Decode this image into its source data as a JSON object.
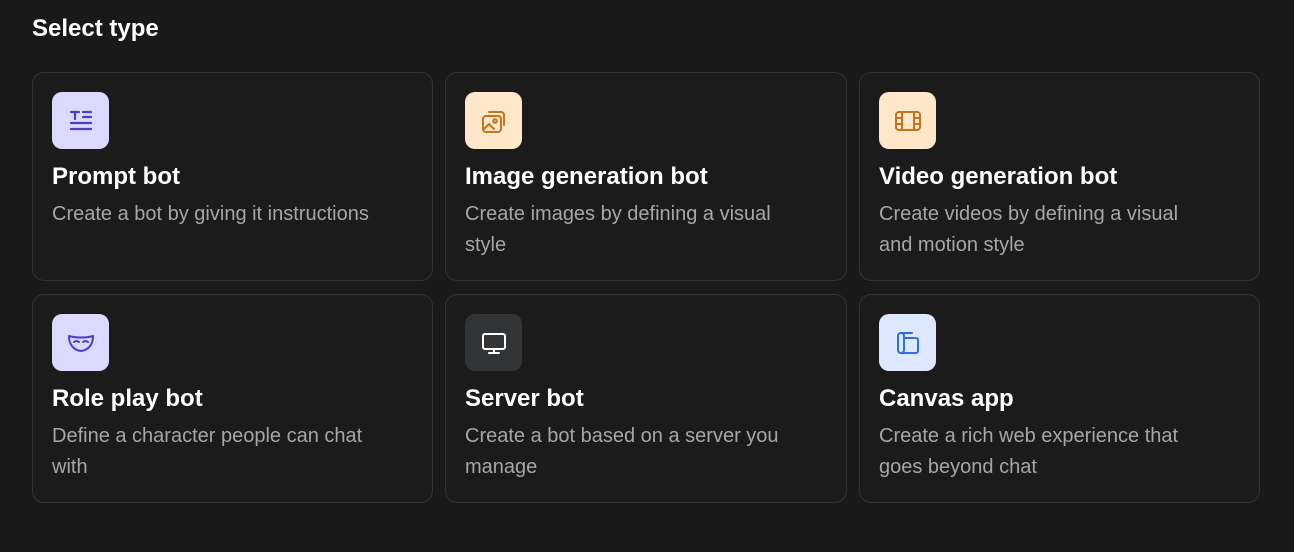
{
  "heading": "Select type",
  "cards": [
    {
      "title": "Prompt bot",
      "description": "Create a bot by giving it instructions",
      "icon": "text-lines-icon",
      "icon_bg": "#dcd9ff",
      "icon_color": "#4a3fc7"
    },
    {
      "title": "Image generation bot",
      "description": "Create images by defining a visual style",
      "icon": "image-stack-icon",
      "icon_bg": "#ffe7c9",
      "icon_color": "#c7731c"
    },
    {
      "title": "Video generation bot",
      "description": "Create videos by defining a visual and motion style",
      "icon": "film-icon",
      "icon_bg": "#ffe7c9",
      "icon_color": "#c7731c"
    },
    {
      "title": "Role play bot",
      "description": "Define a character people can chat with",
      "icon": "mask-icon",
      "icon_bg": "#dcd9ff",
      "icon_color": "#4a3fc7"
    },
    {
      "title": "Server bot",
      "description": "Create a bot based on a server you manage",
      "icon": "monitor-icon",
      "icon_bg": "#333435",
      "icon_color": "#ffffff"
    },
    {
      "title": "Canvas app",
      "description": "Create a rich web experience that goes beyond chat",
      "icon": "canvas-icon",
      "icon_bg": "#dde8ff",
      "icon_color": "#2f6fe0"
    }
  ]
}
